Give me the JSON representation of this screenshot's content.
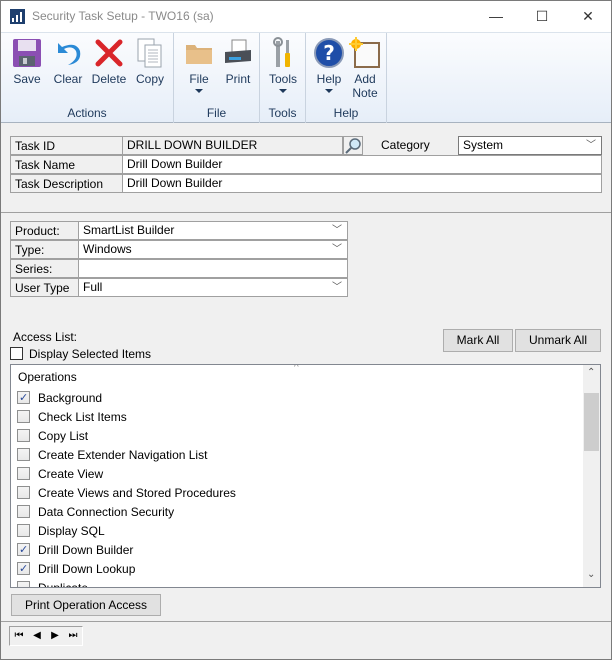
{
  "window": {
    "title": "Security Task Setup  -  TWO16 (sa)",
    "minimize_label": "—",
    "maximize_label": "☐",
    "close_label": "✕"
  },
  "ribbon": {
    "groups": [
      {
        "label": "Actions",
        "buttons": [
          {
            "label": "Save",
            "icon": "save-icon"
          },
          {
            "label": "Clear",
            "icon": "undo-icon"
          },
          {
            "label": "Delete",
            "icon": "delete-icon"
          },
          {
            "label": "Copy",
            "icon": "copy-icon"
          }
        ]
      },
      {
        "label": "File",
        "buttons": [
          {
            "label": "File",
            "icon": "folder-icon",
            "dropdown": true
          },
          {
            "label": "Print",
            "icon": "printer-icon"
          }
        ]
      },
      {
        "label": "Tools",
        "buttons": [
          {
            "label": "Tools",
            "icon": "tools-icon",
            "dropdown": true
          }
        ]
      },
      {
        "label": "Help",
        "buttons": [
          {
            "label": "Help",
            "icon": "help-icon",
            "dropdown": true
          },
          {
            "label": "Add",
            "label2": "Note",
            "icon": "add-note-icon"
          }
        ]
      }
    ]
  },
  "task": {
    "id_label": "Task ID",
    "id_value": "DRILL DOWN BUILDER",
    "name_label": "Task Name",
    "name_value": "Drill Down Builder",
    "desc_label": "Task Description",
    "desc_value": "Drill Down Builder",
    "category_label": "Category",
    "category_value": "System"
  },
  "filters": {
    "product_label": "Product:",
    "product_value": "SmartList Builder",
    "type_label": "Type:",
    "type_value": "Windows",
    "series_label": "Series:",
    "series_value": "",
    "usertype_label": "User Type",
    "usertype_value": "Full"
  },
  "access": {
    "label": "Access List:",
    "display_selected_label": "Display Selected Items",
    "display_selected_checked": false,
    "mark_all": "Mark All",
    "unmark_all": "Unmark All",
    "list_header": "Operations",
    "items": [
      {
        "label": "Background",
        "checked": true
      },
      {
        "label": "Check List Items",
        "checked": false
      },
      {
        "label": "Copy List",
        "checked": false
      },
      {
        "label": "Create Extender Navigation List",
        "checked": false
      },
      {
        "label": "Create View",
        "checked": false
      },
      {
        "label": "Create Views and Stored Procedures",
        "checked": false
      },
      {
        "label": "Data Connection Security",
        "checked": false
      },
      {
        "label": "Display SQL",
        "checked": false
      },
      {
        "label": "Drill Down Builder",
        "checked": true
      },
      {
        "label": "Drill Down Lookup",
        "checked": true
      },
      {
        "label": "Duplicate",
        "checked": false
      }
    ],
    "print_button": "Print Operation Access"
  },
  "navigation": {
    "first": "⏮",
    "prev": "◀",
    "next": "▶",
    "last": "⏭"
  }
}
